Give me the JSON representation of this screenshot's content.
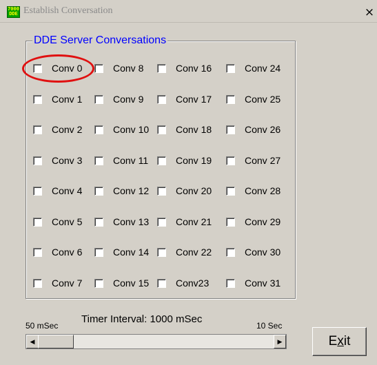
{
  "window": {
    "title": "Establish Conversation",
    "icon": "7000-dde-app-icon",
    "icon_lines": [
      "7000",
      "DDE"
    ],
    "close_label": "×"
  },
  "group": {
    "label": "DDE Server Conversations"
  },
  "conversations": {
    "columns": [
      [
        "Conv 0",
        "Conv 1",
        "Conv 2",
        "Conv 3",
        "Conv 4",
        "Conv 5",
        "Conv 6",
        "Conv 7"
      ],
      [
        "Conv 8",
        "Conv 9",
        "Conv 10",
        "Conv 11",
        "Conv 12",
        "Conv 13",
        "Conv 14",
        "Conv 15"
      ],
      [
        "Conv 16",
        "Conv 17",
        "Conv 18",
        "Conv 19",
        "Conv 20",
        "Conv 21",
        "Conv 22",
        "Conv23"
      ],
      [
        "Conv 24",
        "Conv 25",
        "Conv 26",
        "Conv 27",
        "Conv 28",
        "Conv 29",
        "Conv 30",
        "Conv 31"
      ]
    ],
    "checked": [],
    "highlighted": "Conv 0",
    "highlight_color": "#e01010"
  },
  "timer": {
    "label": "Timer Interval: 1000 mSec",
    "min_label": "50 mSec",
    "max_label": "10 Sec",
    "value_fraction": 0.1
  },
  "exit_button": {
    "label_pre": "E",
    "label_accel": "x",
    "label_post": "it"
  }
}
